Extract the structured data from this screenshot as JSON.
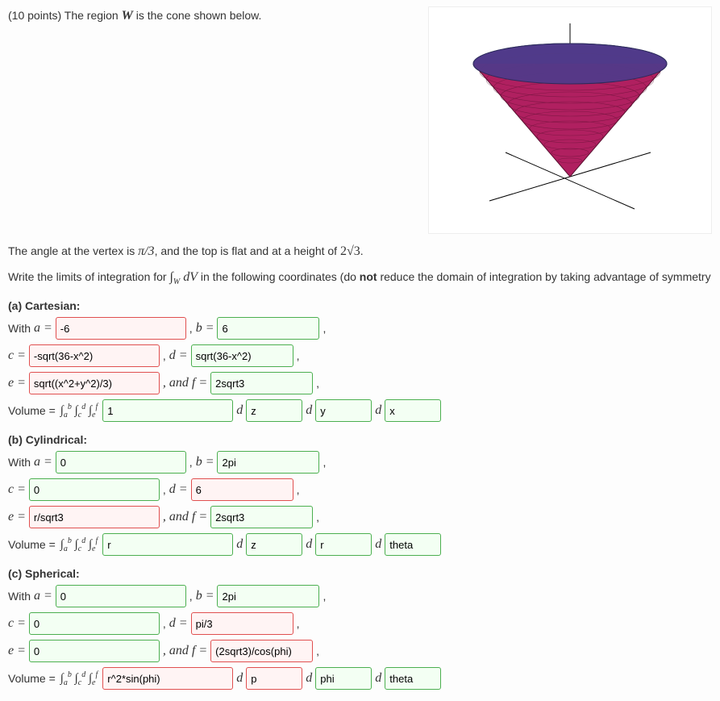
{
  "header": {
    "points_line": "(10 points) The region W is the cone shown below.",
    "angle_line_pre": "The angle at the vertex is ",
    "angle_value": "π/3",
    "angle_line_mid": ", and the top is flat and at a height of ",
    "height_value": "2√3",
    "angle_line_end": ".",
    "instr_pre": "Write the limits of integration for ",
    "instr_integral": "∫",
    "instr_sub": "W",
    "instr_dv": " dV",
    "instr_post": " in the following coordinates (do ",
    "instr_not": "not",
    "instr_tail": " reduce the domain of integration by taking advantage of symmetry"
  },
  "labels": {
    "with": "With ",
    "a_eq": "a = ",
    "b_eq": "b = ",
    "c_eq": "c = ",
    "d_eq": "d = ",
    "e_eq": "e = ",
    "and_f_eq": ", and f = ",
    "volume_eq": "Volume = ",
    "triple_int": "∫ₐᵇ ∫_c^d ∫_e^f",
    "d": "d"
  },
  "parts": {
    "a": {
      "title": "(a) Cartesian:",
      "a": "-6",
      "b": "6",
      "c": "-sqrt(36-x^2)",
      "d": "sqrt(36-x^2)",
      "e": "sqrt((x^2+y^2)/3)",
      "f": "2sqrt3",
      "integrand": "1",
      "d1": "z",
      "d2": "y",
      "d3": "x",
      "status": {
        "a": "wrong",
        "b": "correct",
        "c": "wrong",
        "d": "correct",
        "e": "wrong",
        "f": "correct",
        "integrand": "correct",
        "d1": "correct",
        "d2": "correct",
        "d3": "correct"
      }
    },
    "b": {
      "title": "(b) Cylindrical:",
      "a": "0",
      "b": "2pi",
      "c": "0",
      "d": "6",
      "e": "r/sqrt3",
      "f": "2sqrt3",
      "integrand": "r",
      "d1": "z",
      "d2": "r",
      "d3": "theta",
      "status": {
        "a": "correct",
        "b": "correct",
        "c": "correct",
        "d": "wrong",
        "e": "wrong",
        "f": "correct",
        "integrand": "correct",
        "d1": "correct",
        "d2": "correct",
        "d3": "correct"
      }
    },
    "c": {
      "title": "(c) Spherical:",
      "a": "0",
      "b": "2pi",
      "c": "0",
      "d": "pi/3",
      "e": "0",
      "f": "(2sqrt3)/cos(phi)",
      "integrand": "r^2*sin(phi)",
      "d1": "p",
      "d2": "phi",
      "d3": "theta",
      "status": {
        "a": "correct",
        "b": "correct",
        "c": "correct",
        "d": "wrong",
        "e": "correct",
        "f": "wrong",
        "integrand": "wrong",
        "d1": "wrong",
        "d2": "correct",
        "d3": "correct"
      }
    }
  }
}
